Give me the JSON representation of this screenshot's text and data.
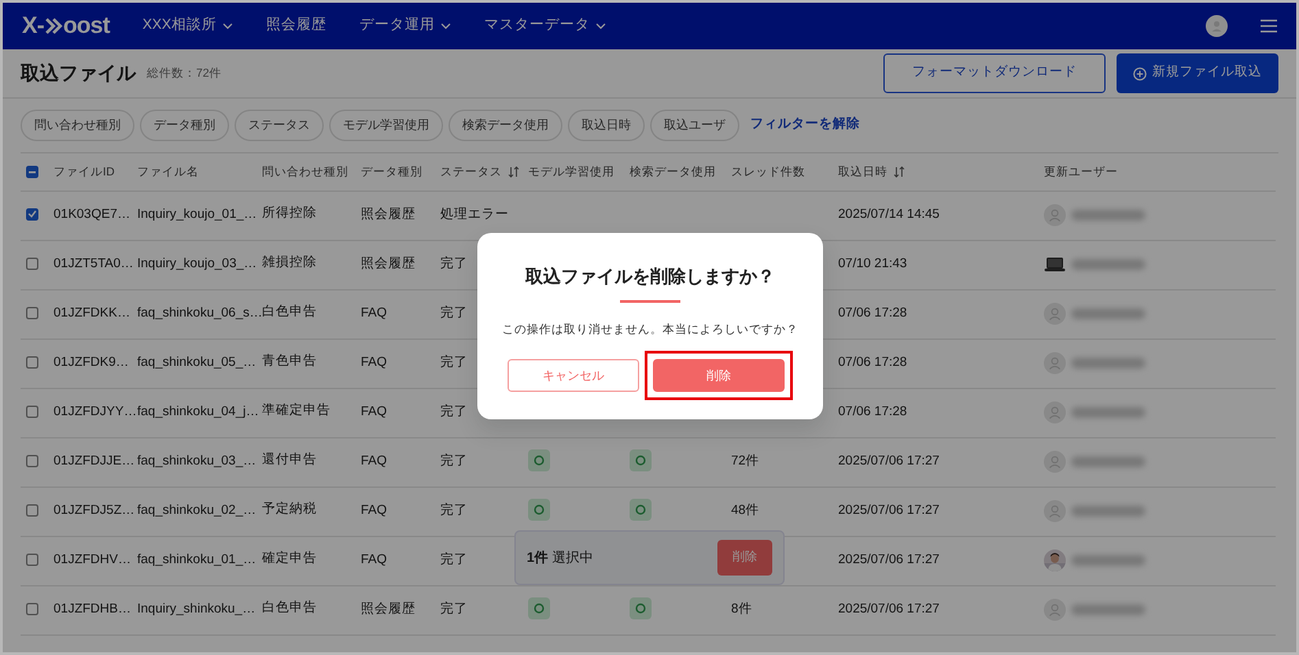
{
  "nav": {
    "logo": {
      "left": "X-",
      "right": "oost"
    },
    "items": [
      {
        "label": "XXX相談所",
        "dropdown": true
      },
      {
        "label": "照会履歴",
        "dropdown": false
      },
      {
        "label": "データ運用",
        "dropdown": true
      },
      {
        "label": "マスターデータ",
        "dropdown": true
      }
    ]
  },
  "page": {
    "title": "取込ファイル",
    "count": "総件数：72件",
    "buttons": [
      {
        "label": "フォーマットダウンロード",
        "kind": "outline"
      },
      {
        "label": "新規ファイル取込",
        "kind": "primary"
      }
    ]
  },
  "filters": {
    "chips": [
      "問い合わせ種別",
      "データ種別",
      "ステータス",
      "モデル学習使用",
      "検索データ使用",
      "取込日時",
      "取込ユーザ"
    ],
    "clear": "フィルターを解除"
  },
  "table": {
    "header_checkbox": {
      "indeterminate": true
    },
    "columns": [
      {
        "label": "ファイルID",
        "sortable": false
      },
      {
        "label": "ファイル名",
        "sortable": false
      },
      {
        "label": "問い合わせ種別",
        "sortable": false
      },
      {
        "label": "データ種別",
        "sortable": false
      },
      {
        "label": "ステータス",
        "sortable": true
      },
      {
        "label": "モデル学習使用",
        "sortable": false
      },
      {
        "label": "検索データ使用",
        "sortable": false
      },
      {
        "label": "スレッド件数",
        "sortable": false
      },
      {
        "label": "取込日時",
        "sortable": true
      },
      {
        "label": "更新ユーザー",
        "sortable": false
      }
    ],
    "rows": [
      {
        "checked": true,
        "file_id": "01K03QE7…",
        "file_name": "Inquiry_koujo_01_…",
        "inquiry_type": "所得控除",
        "data_type": "照会履歴",
        "status": "処理エラー",
        "imported_at": "2025/07/14 14:45",
        "avatar": {
          "kind": "person"
        }
      },
      {
        "checked": false,
        "file_id": "01JZT5TA0…",
        "file_name": "Inquiry_koujo_03_…",
        "inquiry_type": "雑損控除",
        "data_type": "照会履歴",
        "status": "完了",
        "imported_at": "07/10 21:43",
        "avatar": {
          "kind": "laptop"
        }
      },
      {
        "checked": false,
        "file_id": "01JZFDKK…",
        "file_name": "faq_shinkoku_06_s…",
        "inquiry_type": "白色申告",
        "data_type": "FAQ",
        "status": "完了",
        "imported_at": "07/06 17:28",
        "avatar": {
          "kind": "person"
        }
      },
      {
        "checked": false,
        "file_id": "01JZFDK9…",
        "file_name": "faq_shinkoku_05_…",
        "inquiry_type": "青色申告",
        "data_type": "FAQ",
        "status": "完了",
        "imported_at": "07/06 17:28",
        "avatar": {
          "kind": "person"
        }
      },
      {
        "checked": false,
        "file_id": "01JZFDJYY…",
        "file_name": "faq_shinkoku_04_j…",
        "inquiry_type": "準確定申告",
        "data_type": "FAQ",
        "status": "完了",
        "imported_at": "07/06 17:28",
        "avatar": {
          "kind": "person"
        }
      },
      {
        "checked": false,
        "file_id": "01JZFDJJE…",
        "file_name": "faq_shinkoku_03_…",
        "inquiry_type": "還付申告",
        "data_type": "FAQ",
        "status": "完了",
        "model_use": true,
        "search_use": true,
        "threads": "72件",
        "imported_at": "2025/07/06 17:27",
        "avatar": {
          "kind": "person"
        }
      },
      {
        "checked": false,
        "file_id": "01JZFDJ5Z…",
        "file_name": "faq_shinkoku_02_…",
        "inquiry_type": "予定納税",
        "data_type": "FAQ",
        "status": "完了",
        "model_use": true,
        "search_use": true,
        "threads": "48件",
        "imported_at": "2025/07/06 17:27",
        "avatar": {
          "kind": "person"
        }
      },
      {
        "checked": false,
        "file_id": "01JZFDHV…",
        "file_name": "faq_shinkoku_01_…",
        "inquiry_type": "確定申告",
        "data_type": "FAQ",
        "status": "完了",
        "imported_at": "2025/07/06 17:27"
      },
      {
        "checked": false,
        "file_id": "01JZFDHB…",
        "file_name": "Inquiry_shinkoku_…",
        "inquiry_type": "白色申告",
        "data_type": "照会履歴",
        "status": "完了",
        "model_use": true,
        "search_use": true,
        "threads": "8件",
        "imported_at": "2025/07/06 17:27",
        "avatar": {
          "kind": "person"
        }
      }
    ]
  },
  "selection_bar": {
    "text": "**1件** 選択中",
    "button": "削除"
  },
  "dialog": {
    "title": "取込ファイルを削除しますか？",
    "message": "この操作は取り消せません。本当によろしいですか？",
    "buttons": [
      {
        "label": "キャンセル",
        "kind": "outline",
        "highlighted": false
      },
      {
        "label": "削除",
        "kind": "danger",
        "highlighted": true
      }
    ]
  }
}
